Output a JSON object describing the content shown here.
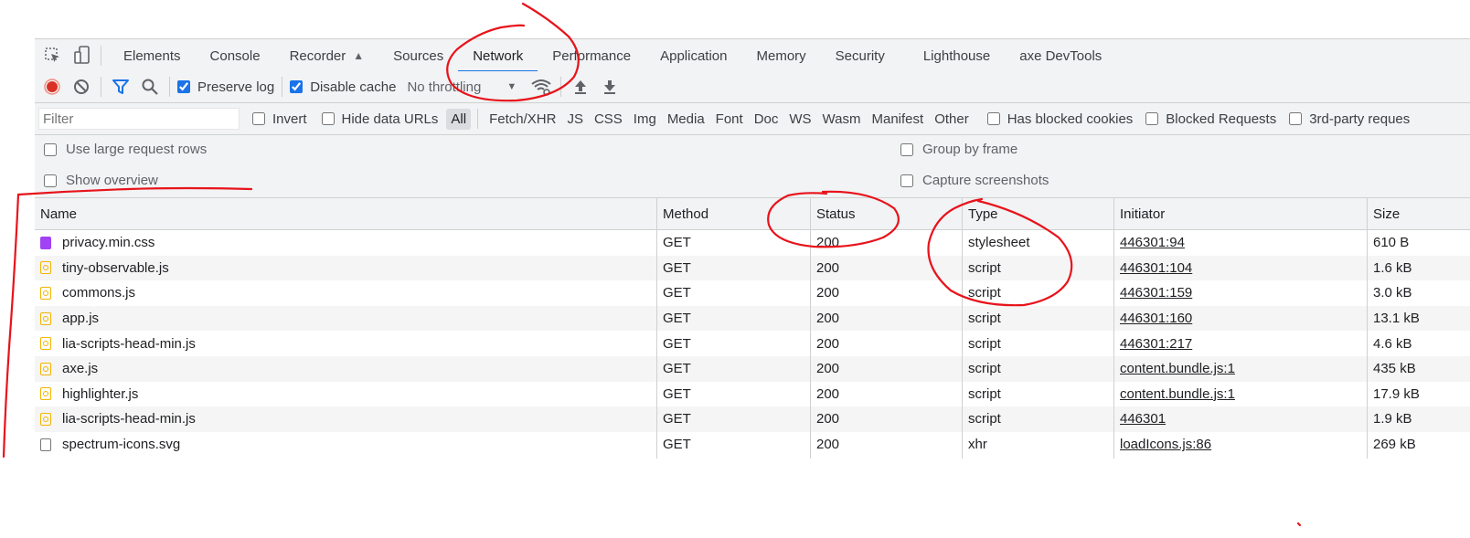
{
  "tabs": [
    "Elements",
    "Console",
    "Recorder",
    "Sources",
    "Network",
    "Performance",
    "Application",
    "Memory",
    "Security",
    "Lighthouse",
    "axe DevTools"
  ],
  "active_tab": "Network",
  "toolbar": {
    "preserve_log_label": "Preserve log",
    "disable_cache_label": "Disable cache",
    "throttling_label": "No throttling"
  },
  "filter": {
    "placeholder": "Filter",
    "invert_label": "Invert",
    "hide_data_urls_label": "Hide data URLs",
    "types": [
      "All",
      "Fetch/XHR",
      "JS",
      "CSS",
      "Img",
      "Media",
      "Font",
      "Doc",
      "WS",
      "Wasm",
      "Manifest",
      "Other"
    ],
    "selected_type": "All",
    "blocked_cookies_label": "Has blocked cookies",
    "blocked_requests_label": "Blocked Requests",
    "third_party_label": "3rd-party reques"
  },
  "settings": {
    "large_rows_label": "Use large request rows",
    "show_overview_label": "Show overview",
    "group_by_frame_label": "Group by frame",
    "capture_screenshots_label": "Capture screenshots"
  },
  "table": {
    "headers": {
      "name": "Name",
      "method": "Method",
      "status": "Status",
      "type": "Type",
      "initiator": "Initiator",
      "size": "Size"
    },
    "rows": [
      {
        "name": "privacy.min.css",
        "icon": "stylesheet",
        "method": "GET",
        "status": "200",
        "type": "stylesheet",
        "initiator": "446301:94",
        "size": "610 B"
      },
      {
        "name": "tiny-observable.js",
        "icon": "script",
        "method": "GET",
        "status": "200",
        "type": "script",
        "initiator": "446301:104",
        "size": "1.6 kB"
      },
      {
        "name": "commons.js",
        "icon": "script",
        "method": "GET",
        "status": "200",
        "type": "script",
        "initiator": "446301:159",
        "size": "3.0 kB"
      },
      {
        "name": "app.js",
        "icon": "script",
        "method": "GET",
        "status": "200",
        "type": "script",
        "initiator": "446301:160",
        "size": "13.1 kB"
      },
      {
        "name": "lia-scripts-head-min.js",
        "icon": "script",
        "method": "GET",
        "status": "200",
        "type": "script",
        "initiator": "446301:217",
        "size": "4.6 kB"
      },
      {
        "name": "axe.js",
        "icon": "script",
        "method": "GET",
        "status": "200",
        "type": "script",
        "initiator": "content.bundle.js:1",
        "size": "435 kB"
      },
      {
        "name": "highlighter.js",
        "icon": "script",
        "method": "GET",
        "status": "200",
        "type": "script",
        "initiator": "content.bundle.js:1",
        "size": "17.9 kB"
      },
      {
        "name": "lia-scripts-head-min.js",
        "icon": "script",
        "method": "GET",
        "status": "200",
        "type": "script",
        "initiator": "446301",
        "size": "1.9 kB"
      },
      {
        "name": "spectrum-icons.svg",
        "icon": "doc",
        "method": "GET",
        "status": "200",
        "type": "xhr",
        "initiator": "loadIcons.js:86",
        "size": "269 kB"
      }
    ]
  },
  "colors": {
    "accent": "#1a73e8",
    "record": "#d93025",
    "annotation": "#e8131b"
  }
}
